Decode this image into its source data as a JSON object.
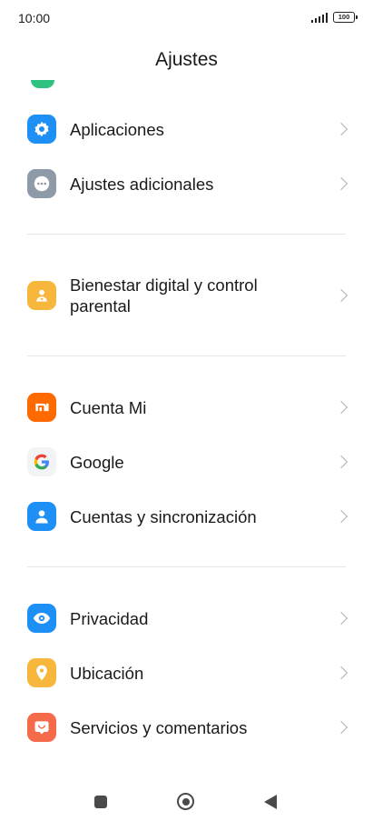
{
  "status_bar": {
    "time": "10:00",
    "battery": "100"
  },
  "header": {
    "title": "Ajustes"
  },
  "items": [
    {
      "id": "apps",
      "label": "Aplicaciones",
      "icon": "gear-icon",
      "color": "#1e90f5"
    },
    {
      "id": "additional",
      "label": "Ajustes adicionales",
      "icon": "more-dots-icon",
      "color": "#8e9aa8"
    },
    {
      "id": "wellbeing",
      "label": "Bienestar digital y control parental",
      "icon": "person-heart-icon",
      "color": "#f6b73c"
    },
    {
      "id": "mi-account",
      "label": "Cuenta Mi",
      "icon": "mi-logo-icon",
      "color": "#ff6a00"
    },
    {
      "id": "google",
      "label": "Google",
      "icon": "google-icon",
      "color": "#f1f3f4"
    },
    {
      "id": "accounts",
      "label": "Cuentas y sincronización",
      "icon": "user-icon",
      "color": "#1e90f5"
    },
    {
      "id": "privacy",
      "label": "Privacidad",
      "icon": "eye-icon",
      "color": "#1e90f5"
    },
    {
      "id": "location",
      "label": "Ubicación",
      "icon": "location-pin-icon",
      "color": "#f6b73c"
    },
    {
      "id": "feedback",
      "label": "Servicios y comentarios",
      "icon": "feedback-icon",
      "color": "#f56b4a"
    }
  ]
}
